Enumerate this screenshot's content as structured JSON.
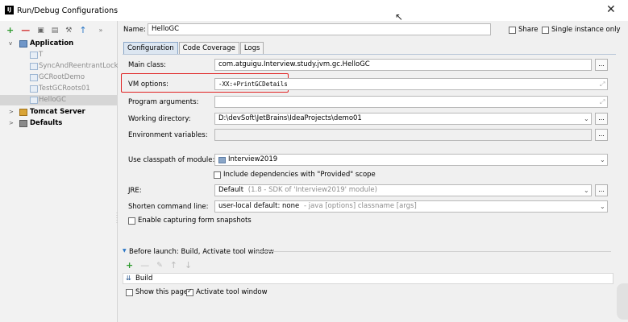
{
  "window": {
    "title": "Run/Debug Configurations",
    "close_glyph": "✕",
    "icon_label": "IJ"
  },
  "sidebar": {
    "toolbar": {
      "add": "+",
      "remove": "—",
      "copy": "▣",
      "save": "▤",
      "settings": "⚒",
      "move_up": "↑",
      "more": "»"
    },
    "tree": [
      {
        "label": "Application",
        "level": 0,
        "expanded": true,
        "bold": true,
        "icon": "application-icon"
      },
      {
        "label": "T",
        "level": 1,
        "bold": false,
        "icon": "class-icon"
      },
      {
        "label": "SyncAndReentrantLockDemo",
        "level": 1,
        "bold": false,
        "icon": "class-icon"
      },
      {
        "label": "GCRootDemo",
        "level": 1,
        "bold": false,
        "icon": "class-icon"
      },
      {
        "label": "TestGCRoots01",
        "level": 1,
        "bold": false,
        "icon": "class-icon"
      },
      {
        "label": "HelloGC",
        "level": 1,
        "bold": false,
        "icon": "class-icon",
        "selected": true
      },
      {
        "label": "Tomcat Server",
        "level": 0,
        "expanded": false,
        "bold": true,
        "icon": "tomcat-icon"
      },
      {
        "label": "Defaults",
        "level": 0,
        "expanded": false,
        "bold": true,
        "icon": "defaults-icon"
      }
    ]
  },
  "header": {
    "name_label": "Name:",
    "name_value": "HelloGC",
    "share_label": "Share",
    "single_instance_label": "Single instance only"
  },
  "tabs": [
    {
      "label": "Configuration",
      "active": true
    },
    {
      "label": "Code Coverage",
      "active": false
    },
    {
      "label": "Logs",
      "active": false
    }
  ],
  "config": {
    "main_class_label": "Main class:",
    "main_class_value": "com.atguigu.Interview.study.jvm.gc.HelloGC",
    "vm_options_label": "VM options:",
    "vm_options_value": "-XX:+PrintGCDetails",
    "program_args_label": "Program arguments:",
    "program_args_value": "",
    "working_dir_label": "Working directory:",
    "working_dir_value": "D:\\devSoft\\JetBrains\\IdeaProjects\\demo01",
    "env_vars_label": "Environment variables:",
    "env_vars_value": "",
    "classpath_label": "Use classpath of module:",
    "classpath_value": "Interview2019",
    "include_provided_label": "Include dependencies with \"Provided\" scope",
    "jre_label": "JRE:",
    "jre_value": "Default",
    "jre_hint": "(1.8 - SDK of 'Interview2019' module)",
    "shorten_label": "Shorten command line:",
    "shorten_value": "user-local default: none",
    "shorten_hint": "- java [options] classname [args]",
    "capture_snapshots_label": "Enable capturing form snapshots",
    "dots": "..."
  },
  "before_launch": {
    "title": "Before launch: Build, Activate tool window",
    "toolbar": {
      "add": "+",
      "remove": "—",
      "edit": "✎",
      "up": "↑",
      "down": "↓"
    },
    "build_label": "Build",
    "show_page_label": "Show this page",
    "activate_label": "Activate tool window"
  },
  "colors": {
    "highlight_border": "#e02020",
    "active_tab": "#dce6f1",
    "selected_row": "#d6d6d6",
    "add_green": "#2c9a2c",
    "remove_red": "#d23030"
  }
}
